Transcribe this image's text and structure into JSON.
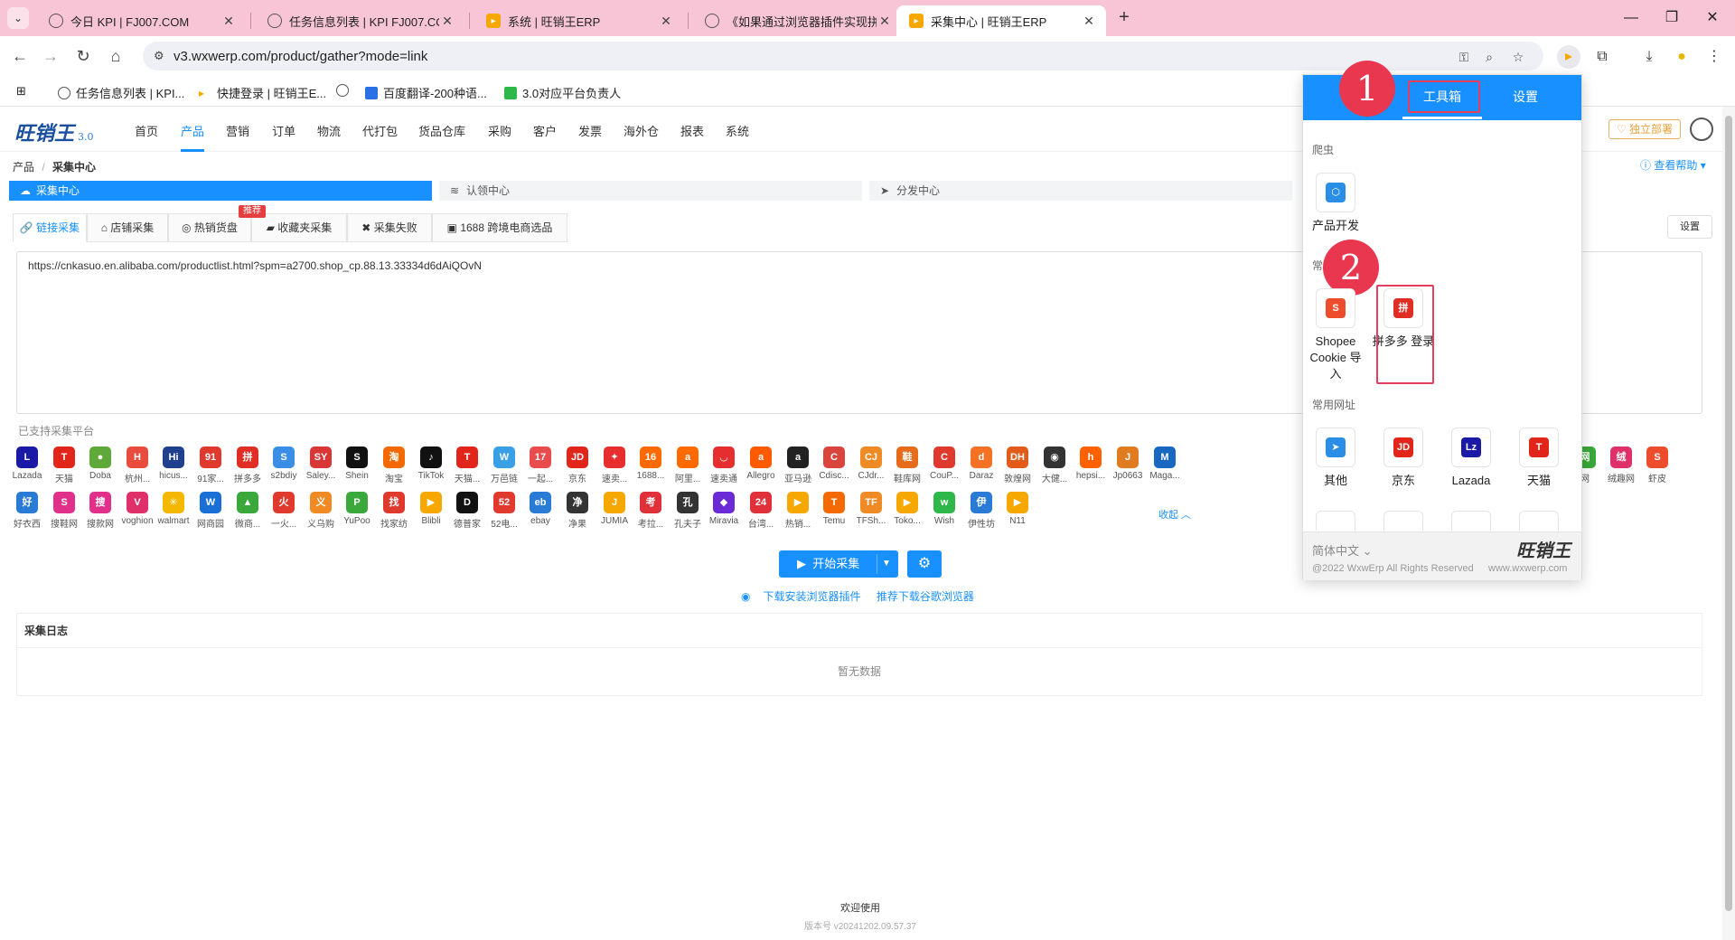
{
  "browser": {
    "tabs": [
      {
        "title": "今日 KPI | FJ007.COM",
        "icon": "globe-icon"
      },
      {
        "title": "任务信息列表 | KPI FJ007.COM",
        "icon": "globe-icon"
      },
      {
        "title": "系统 | 旺销王ERP",
        "icon": "erp-icon"
      },
      {
        "title": "《如果通过浏览器插件实现拼多",
        "icon": "globe-icon"
      },
      {
        "title": "采集中心 | 旺销王ERP",
        "icon": "erp-icon",
        "active": true
      }
    ],
    "url": "v3.wxwerp.com/product/gather?mode=link",
    "bookmarks": [
      {
        "label": "任务信息列表 | KPI..."
      },
      {
        "label": "快捷登录 | 旺销王E..."
      },
      {
        "label": ""
      },
      {
        "label": "百度翻译-200种语..."
      },
      {
        "label": "3.0对应平台负责人"
      }
    ]
  },
  "app": {
    "version": "3.0",
    "menu": [
      "首页",
      "产品",
      "营销",
      "订单",
      "物流",
      "代打包",
      "货品仓库",
      "采购",
      "客户",
      "发票",
      "海外仓",
      "报表",
      "系统"
    ],
    "active_menu": "产品",
    "deploy_label": "独立部署",
    "breadcrumb": {
      "parent": "产品",
      "current": "采集中心"
    },
    "help_label": "查看帮助",
    "steps": [
      "采集中心",
      "认领中心",
      "分发中心"
    ],
    "subtabs": [
      "链接采集",
      "店铺采集",
      "热销货盘",
      "收藏夹采集",
      "采集失败",
      "1688 跨境电商选品"
    ],
    "hot_badge": "推荐",
    "settings_label": "设置",
    "link_text": "https://cnkasuo.en.alibaba.com/productlist.html?spm=a2700.shop_cp.88.13.33334d6dAiQOvN",
    "supported_label": "已支持采集平台",
    "platforms_row1": [
      {
        "name": "Lazada",
        "color": "#1a1aa6",
        "glyph": "L"
      },
      {
        "name": "天猫",
        "color": "#e1251b",
        "glyph": "T"
      },
      {
        "name": "Doba",
        "color": "#5fa83a",
        "glyph": "●"
      },
      {
        "name": "杭州...",
        "color": "#e74c3c",
        "glyph": "H"
      },
      {
        "name": "hicus...",
        "color": "#1f3f8f",
        "glyph": "Hi"
      },
      {
        "name": "91家...",
        "color": "#e03a2f",
        "glyph": "91"
      },
      {
        "name": "拼多多",
        "color": "#e02e24",
        "glyph": "拼"
      },
      {
        "name": "s2bdiy",
        "color": "#3a8ee6",
        "glyph": "S"
      },
      {
        "name": "Saley...",
        "color": "#d93636",
        "glyph": "SY"
      },
      {
        "name": "Shein",
        "color": "#111",
        "glyph": "S"
      },
      {
        "name": "淘宝",
        "color": "#f56a00",
        "glyph": "淘"
      },
      {
        "name": "TikTok",
        "color": "#111",
        "glyph": "♪"
      },
      {
        "name": "天猫...",
        "color": "#e1251b",
        "glyph": "T"
      },
      {
        "name": "万邑链",
        "color": "#3aa0e6",
        "glyph": "W"
      },
      {
        "name": "一起...",
        "color": "#e94c4c",
        "glyph": "17"
      },
      {
        "name": "京东",
        "color": "#e1251b",
        "glyph": "JD"
      },
      {
        "name": "速卖...",
        "color": "#e62e2e",
        "glyph": "✦"
      },
      {
        "name": "1688...",
        "color": "#ff6a00",
        "glyph": "16"
      },
      {
        "name": "阿里...",
        "color": "#ff6a00",
        "glyph": "a"
      },
      {
        "name": "速卖通",
        "color": "#e62e2e",
        "glyph": "◡"
      },
      {
        "name": "Allegro",
        "color": "#ff5a00",
        "glyph": "a"
      },
      {
        "name": "亚马逊",
        "color": "#222",
        "glyph": "a"
      },
      {
        "name": "Cdisc...",
        "color": "#d9453d",
        "glyph": "C"
      },
      {
        "name": "CJdr...",
        "color": "#f08a24",
        "glyph": "CJ"
      },
      {
        "name": "鞋库网",
        "color": "#e66b1a",
        "glyph": "鞋"
      },
      {
        "name": "CouP...",
        "color": "#e03a2f",
        "glyph": "C"
      },
      {
        "name": "Daraz",
        "color": "#f57224",
        "glyph": "d"
      },
      {
        "name": "敦煌网",
        "color": "#e35b1a",
        "glyph": "DH"
      },
      {
        "name": "大健...",
        "color": "#333",
        "glyph": "◉"
      },
      {
        "name": "hepsi...",
        "color": "#ff6000",
        "glyph": "h"
      },
      {
        "name": "Jp0663",
        "color": "#e07b20",
        "glyph": "J"
      },
      {
        "name": "Maga...",
        "color": "#1867c0",
        "glyph": "M"
      }
    ],
    "platforms_row2": [
      {
        "name": "好衣西",
        "color": "#2a7bd6",
        "glyph": "好"
      },
      {
        "name": "搜鞋网",
        "color": "#e0308a",
        "glyph": "S"
      },
      {
        "name": "搜款网",
        "color": "#e0308a",
        "glyph": "搜"
      },
      {
        "name": "voghion",
        "color": "#e0306a",
        "glyph": "V"
      },
      {
        "name": "walmart",
        "color": "#f5b800",
        "glyph": "✳"
      },
      {
        "name": "网商园",
        "color": "#1a6fd6",
        "glyph": "W"
      },
      {
        "name": "微商...",
        "color": "#3aa83a",
        "glyph": "▲"
      },
      {
        "name": "一火...",
        "color": "#e03a2f",
        "glyph": "火"
      },
      {
        "name": "义乌购",
        "color": "#f08a24",
        "glyph": "义"
      },
      {
        "name": "YuPoo",
        "color": "#3aa83a",
        "glyph": "P"
      },
      {
        "name": "找家纺",
        "color": "#e03a2f",
        "glyph": "找"
      },
      {
        "name": "Blibli",
        "color": "#f6a800",
        "glyph": "▶"
      },
      {
        "name": "德普家",
        "color": "#111",
        "glyph": "D"
      },
      {
        "name": "52电...",
        "color": "#e03a2f",
        "glyph": "52"
      },
      {
        "name": "ebay",
        "color": "#2a7bd6",
        "glyph": "eb"
      },
      {
        "name": "净果",
        "color": "#333",
        "glyph": "净"
      },
      {
        "name": "JUMIA",
        "color": "#f6a800",
        "glyph": "J"
      },
      {
        "name": "考拉...",
        "color": "#e0303a",
        "glyph": "考"
      },
      {
        "name": "孔夫子",
        "color": "#333",
        "glyph": "孔"
      },
      {
        "name": "Miravia",
        "color": "#6a2ad6",
        "glyph": "◆"
      },
      {
        "name": "台湾...",
        "color": "#e0303a",
        "glyph": "24"
      },
      {
        "name": "热销...",
        "color": "#f6a800",
        "glyph": "▶"
      },
      {
        "name": "Temu",
        "color": "#f56a00",
        "glyph": "T"
      },
      {
        "name": "TFSh...",
        "color": "#f08a24",
        "glyph": "TF"
      },
      {
        "name": "Toko...",
        "color": "#f6a800",
        "glyph": "▶"
      },
      {
        "name": "Wish",
        "color": "#2fb84a",
        "glyph": "w"
      },
      {
        "name": "伊性坊",
        "color": "#2a7bd6",
        "glyph": "伊"
      },
      {
        "name": "N11",
        "color": "#f6a800",
        "glyph": "▶"
      }
    ],
    "platforms_right": [
      {
        "name": "网",
        "color": "#3aa83a",
        "glyph": "网"
      },
      {
        "name": "绒趣网",
        "color": "#e0306a",
        "glyph": "绒"
      },
      {
        "name": "虾皮",
        "color": "#ee4d2d",
        "glyph": "S"
      }
    ],
    "collapse_label": "收起",
    "start_button": "开始采集",
    "download_plugin": "下载安装浏览器插件",
    "download_chrome": "推荐下载谷歌浏览器",
    "log_title": "采集日志",
    "log_empty": "暂无数据",
    "footer_welcome": "欢迎使用",
    "footer_version": "版本号 v20241202.09.57.37"
  },
  "popup": {
    "tabs": [
      "工具箱",
      "设置"
    ],
    "sec_crawler": "爬虫",
    "sec_common": "常",
    "sec_urls": "常用网址",
    "crawler_items": [
      {
        "label": "产品开发",
        "color": "#2a8ee6",
        "glyph": "⬡"
      }
    ],
    "common_items": [
      {
        "label": "Shopee Cookie 导入",
        "color": "#ee4d2d",
        "glyph": "S"
      },
      {
        "label": "拼多多 登录",
        "color": "#e02e24",
        "glyph": "拼"
      }
    ],
    "url_items": [
      {
        "label": "其他",
        "color": "#2a8ee6",
        "glyph": "➤"
      },
      {
        "label": "京东",
        "color": "#e1251b",
        "glyph": "JD"
      },
      {
        "label": "Lazada",
        "color": "#1a1aa6",
        "glyph": "Lz"
      },
      {
        "label": "天猫",
        "color": "#e1251b",
        "glyph": "T"
      }
    ],
    "more_items": [
      {
        "color": "#e0303a"
      },
      {
        "color": "#f08a24"
      },
      {
        "color": "#f6a800"
      },
      {
        "color": "#e02e24"
      }
    ],
    "step_markers": [
      "1",
      "2"
    ],
    "lang": "简体中文",
    "copyright": "@2022 WxwErp All Rights Reserved",
    "site": "www.wxwerp.com"
  },
  "colors": {
    "primary": "#1890ff",
    "highlight": "#e8374f",
    "tabbar": "#f7c5d5"
  }
}
